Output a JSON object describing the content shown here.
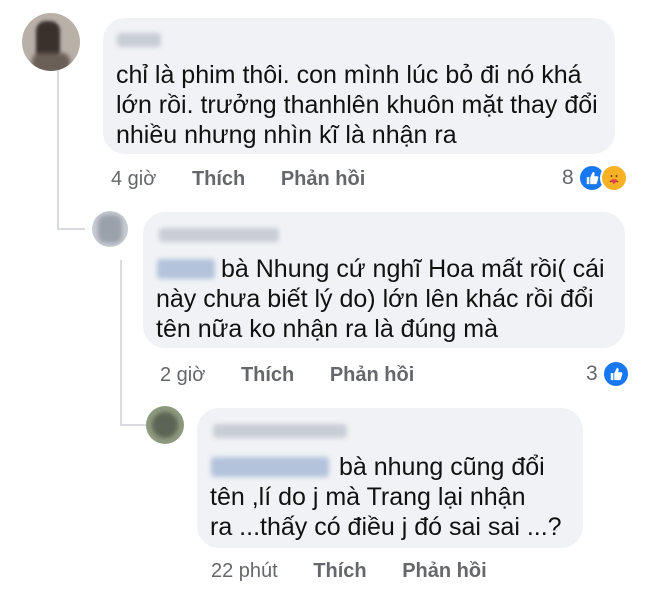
{
  "comments": [
    {
      "lines": [
        "chỉ là phim thôi. con mình lúc bỏ đi nó khá",
        "lớn rồi. trưởng thanhlên khuôn mặt thay đổi",
        "nhiều nhưng nhìn kĩ là nhận ra"
      ],
      "time": "4 giờ",
      "like_label": "Thích",
      "reply_label": "Phản hồi",
      "reaction_count": "8",
      "reactions": [
        "like-icon",
        "care-icon"
      ]
    },
    {
      "lines": [
        "bà Nhung cứ nghĩ Hoa mất rồi( cái",
        "này chưa biết lý do) lớn lên khác rồi đổi",
        "tên nữa ko nhận ra là đúng mà"
      ],
      "time": "2 giờ",
      "like_label": "Thích",
      "reply_label": "Phản hồi",
      "reaction_count": "3",
      "reactions": [
        "like-icon"
      ]
    },
    {
      "lines": [
        "bà nhung cũng đổi",
        "tên ,lí do j mà Trang lại nhận",
        "ra ...thấy có điều j đó sai sai ...?"
      ],
      "time": "22 phút",
      "like_label": "Thích",
      "reply_label": "Phản hồi"
    }
  ],
  "colors": {
    "bubble": "#f0f2f5",
    "like": "#1877f2",
    "meta_text": "#65676b"
  }
}
